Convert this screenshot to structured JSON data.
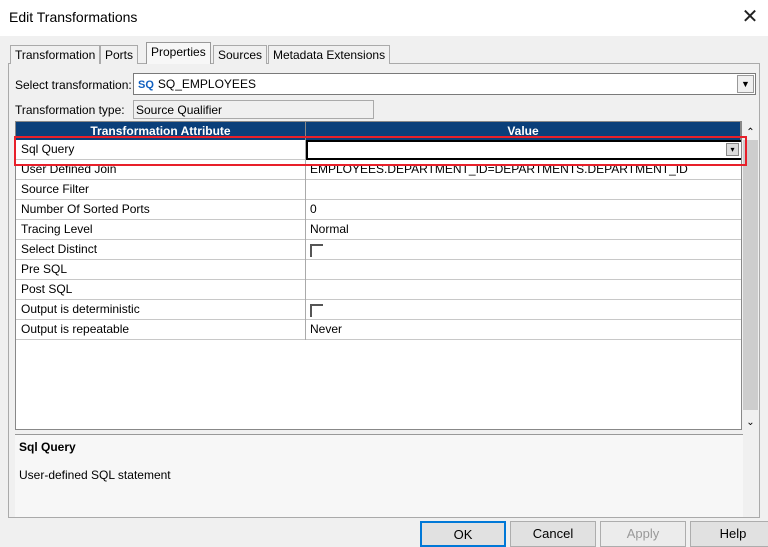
{
  "window": {
    "title": "Edit Transformations"
  },
  "tabs": [
    {
      "label": "Transformation"
    },
    {
      "label": "Ports"
    },
    {
      "label": "Properties",
      "active": true
    },
    {
      "label": "Sources"
    },
    {
      "label": "Metadata Extensions"
    }
  ],
  "form": {
    "select_label": "Select transformation:",
    "select_icon_text": "SQ",
    "select_value": "SQ_EMPLOYEES",
    "type_label": "Transformation type:",
    "type_value": "Source Qualifier"
  },
  "grid": {
    "headers": [
      "Transformation Attribute",
      "Value"
    ],
    "rows": [
      {
        "attr": "Sql Query",
        "value": ""
      },
      {
        "attr": "User Defined Join",
        "value": "EMPLOYEES.DEPARTMENT_ID=DEPARTMENTS.DEPARTMENT_ID"
      },
      {
        "attr": "Source Filter",
        "value": ""
      },
      {
        "attr": "Number Of Sorted Ports",
        "value": "0"
      },
      {
        "attr": "Tracing Level",
        "value": "Normal"
      },
      {
        "attr": "Select Distinct",
        "checkbox": false
      },
      {
        "attr": "Pre SQL",
        "value": ""
      },
      {
        "attr": "Post SQL",
        "value": ""
      },
      {
        "attr": "Output is deterministic",
        "checkbox": false
      },
      {
        "attr": "Output is repeatable",
        "value": "Never"
      }
    ]
  },
  "description": {
    "title": "Sql Query",
    "text": "User-defined SQL statement"
  },
  "buttons": {
    "ok": "OK",
    "cancel": "Cancel",
    "apply": "Apply",
    "help": "Help"
  },
  "colors": {
    "header": "#0a3f7a",
    "highlight": "#e8202a"
  }
}
